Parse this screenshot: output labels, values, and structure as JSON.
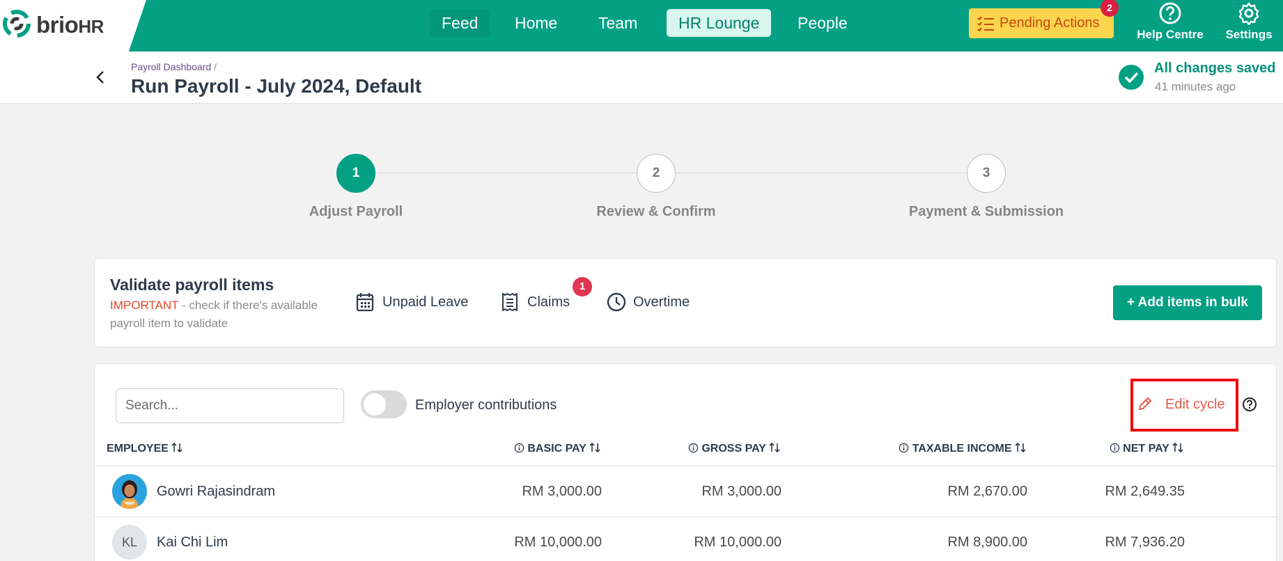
{
  "brand": {
    "name": "brio",
    "suffix": "HR"
  },
  "nav": {
    "feed": "Feed",
    "home": "Home",
    "team": "Team",
    "hr_lounge": "HR Lounge",
    "people": "People"
  },
  "pending": {
    "label": "Pending Actions",
    "count": "2"
  },
  "help": {
    "label": "Help Centre"
  },
  "settings": {
    "label": "Settings"
  },
  "breadcrumb": {
    "parent": "Payroll Dashboard",
    "sep": "/"
  },
  "page_title": "Run Payroll - July 2024, Default",
  "save_status": {
    "title": "All changes saved",
    "time": "41 minutes ago"
  },
  "steps": [
    {
      "num": "1",
      "label": "Adjust Payroll"
    },
    {
      "num": "2",
      "label": "Review & Confirm"
    },
    {
      "num": "3",
      "label": "Payment & Submission"
    }
  ],
  "validate": {
    "title": "Validate payroll items",
    "important": "IMPORTANT",
    "desc": " - check if there's available payroll item to validate",
    "items": {
      "unpaid_leave": "Unpaid Leave",
      "claims": "Claims",
      "overtime": "Overtime"
    },
    "claims_count": "1",
    "bulk_button": "+ Add items in bulk"
  },
  "table": {
    "search_placeholder": "Search...",
    "toggle_label": "Employer contributions",
    "edit_cycle": "Edit cycle",
    "headers": {
      "employee": "EMPLOYEE",
      "basic": "BASIC PAY",
      "gross": "GROSS PAY",
      "taxable": "TAXABLE INCOME",
      "net": "NET PAY"
    },
    "rows": [
      {
        "name": "Gowri Rajasindram",
        "initials": "",
        "basic": "RM 3,000.00",
        "gross": "RM 3,000.00",
        "taxable": "RM 2,670.00",
        "net": "RM 2,649.35"
      },
      {
        "name": "Kai Chi Lim",
        "initials": "KL",
        "basic": "RM 10,000.00",
        "gross": "RM 10,000.00",
        "taxable": "RM 8,900.00",
        "net": "RM 7,936.20"
      }
    ]
  },
  "colors": {
    "brand": "#04a084",
    "pending": "#fbd54e",
    "alert": "#ee0d0d"
  }
}
